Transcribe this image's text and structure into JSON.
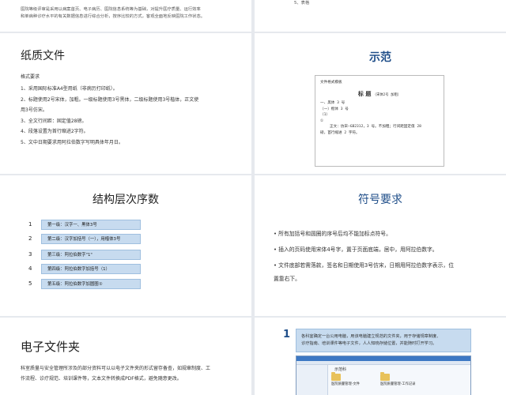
{
  "top_left": {
    "lines": [
      "医院等级评审是采用以病案首页、电子病历、医院信息系统等为基础，对提升医疗质量、运行效率",
      "和单病种诊疗水平的有关数据信息进行综合分析，按序比较的方式，客观全面地反映医院工作状态。"
    ]
  },
  "top_right": {
    "item": "5、表格"
  },
  "paper": {
    "title": "纸质文件",
    "subtitle": "格式要求",
    "items": [
      "1、采用国际标准A4型用纸（非病历打印纸）。",
      "2、标题使用2号宋体，加粗。一级标题使用3号黑体，二级标题使用3号楷体，正文使",
      "用3号仿宋。",
      "3、全文行间距：固定值28磅。",
      "4、段落设置为首行缩进2字符。",
      "5、文中日期要求用阿拉伯数字写明具体年月日。"
    ]
  },
  "sample": {
    "title": "示范",
    "doc_lines": {
      "header": "文件格式模板",
      "title": "标 题",
      "title_note": "（宋体2号 加粗）",
      "l1": "一、黑体 3 号",
      "l2": "（一）楷体 3 号",
      "l3": "（1）",
      "l4": "①",
      "body1": "正文：仿宋—GB2312，3 号。不加粗；行间距固定值 28",
      "body2": "磅，首行缩进 2 字符。"
    }
  },
  "levels": {
    "title": "结构层次序数",
    "rows": [
      {
        "num": "1",
        "label": "第一级：汉字一、黑体3号"
      },
      {
        "num": "2",
        "label": "第二级：汉字加括号（一），用楷体3号"
      },
      {
        "num": "3",
        "label": "第三级：阿拉伯数字\"1\""
      },
      {
        "num": "4",
        "label": "第四级：阿拉伯数字加括号（1）"
      },
      {
        "num": "5",
        "label": "第五级：阿拉伯数字加圆圈①"
      }
    ]
  },
  "symbols": {
    "title": "符号要求",
    "bullets": [
      "• 所有加括号和圆圈的序号后均不能加标点符号。",
      "• 插入的页码使用宋体4号字，置于页面底端，居中，用阿拉伯数字。",
      "• 文件底部若需落款，签名和日期使用3号仿宋，日期用阿拉伯数字表示，位",
      "   置靠右下。"
    ]
  },
  "efolder": {
    "title": "电子文件夹",
    "lines": [
      "科室质量与安全管理所涉及的部分资料可以以电子文件夹的形式留存备查，如规章制度、工",
      "作流程、诊疗规范、培训课件等，文本文件转换成PDF格式，避免随意更改。"
    ]
  },
  "step": {
    "num": "1",
    "lines": [
      "各科室确定一台公用电脑，用该电脑建立规范的文件夹，用于存储规章制度、",
      "诊疗指南、培训课件等电子文件，人人知晓存储位置，并能随时打开学习。"
    ],
    "explorer": {
      "folder_name": "示范科",
      "file1": "医院质量管理-文件",
      "file2": "医院质量管理-工作记录"
    }
  }
}
